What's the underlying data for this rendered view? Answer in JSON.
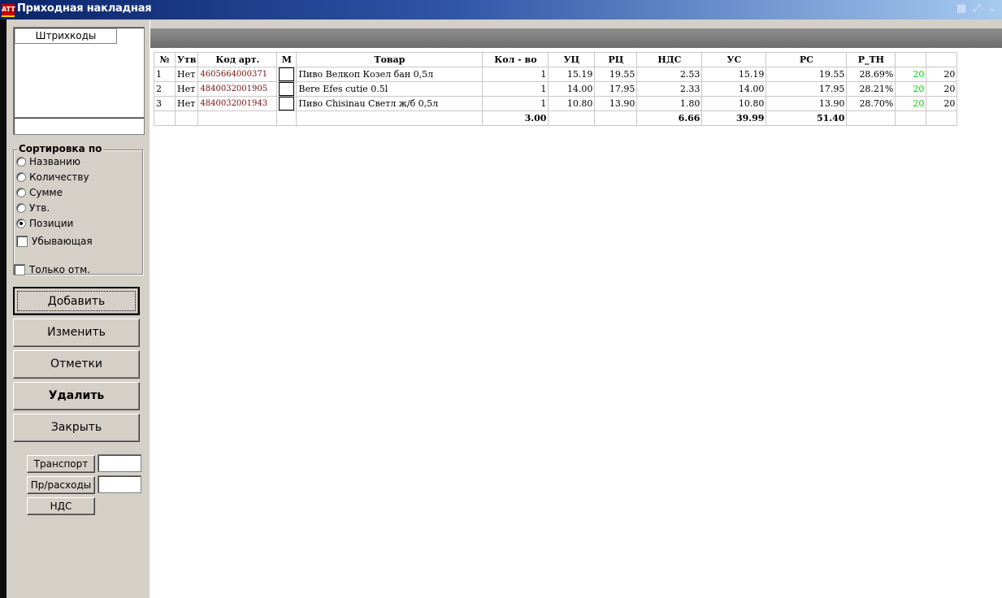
{
  "window": {
    "title": "Приходная накладная",
    "icon": "app-logo-icon",
    "icon_text": "ATT"
  },
  "left_panel": {
    "barcodes_header": "Штрихкоды",
    "search_value": "",
    "sort": {
      "title": "Сортировка по",
      "options": [
        "Названию",
        "Количеству",
        "Сумме",
        "Утв.",
        "Позиции"
      ],
      "selected": "Позиции",
      "descending_label": "Убывающая",
      "descending_checked": false
    },
    "only_marked_label": "Только отм.",
    "only_marked_checked": false,
    "buttons": {
      "add": "Добавить",
      "edit": "Изменить",
      "marks": "Отметки",
      "delete": "Удалить",
      "close": "Закрыть"
    },
    "transport_label": "Транспорт",
    "transport_value": "",
    "other_expenses_label": "Пр/расходы",
    "other_expenses_value": "",
    "vat_label": "НДС"
  },
  "table": {
    "headers": [
      "№",
      "Утв",
      "Код арт.",
      "М",
      "Товар",
      "Кол - во",
      "УЦ",
      "РЦ",
      "НДС",
      "УС",
      "РС",
      "Р_ТН",
      "",
      ""
    ],
    "rows": [
      {
        "n": "1",
        "approved": "Нет",
        "code": "4605664000371",
        "marked": false,
        "product": "Пиво Велкоп Козел бан 0,5л",
        "qty": "1",
        "uc": "15.19",
        "rc": "19.55",
        "vat": "2.53",
        "us": "15.19",
        "rs": "19.55",
        "r_tn": "28.69%",
        "c13": "20",
        "c14": "20"
      },
      {
        "n": "2",
        "approved": "Нет",
        "code": "4840032001905",
        "marked": false,
        "product": "Bere Efes  cutie 0.5l",
        "qty": "1",
        "uc": "14.00",
        "rc": "17.95",
        "vat": "2.33",
        "us": "14.00",
        "rs": "17.95",
        "r_tn": "28.21%",
        "c13": "20",
        "c14": "20"
      },
      {
        "n": "3",
        "approved": "Нет",
        "code": "4840032001943",
        "marked": false,
        "product": "Пиво Chisinau Светл ж/б 0,5л",
        "qty": "1",
        "uc": "10.80",
        "rc": "13.90",
        "vat": "1.80",
        "us": "10.80",
        "rs": "13.90",
        "r_tn": "28.70%",
        "c13": "20",
        "c14": "20"
      }
    ],
    "totals": {
      "qty": "3.00",
      "vat": "6.66",
      "us": "39.99",
      "rs": "51.40"
    }
  },
  "colors": {
    "title_gradient_start": "#0a246a",
    "title_gradient_end": "#a6caf0",
    "panel_bg": "#d4d0c8",
    "code_text": "#7a0f0f",
    "percent_green": "#00d000",
    "grid_header_bar": "#7a7a7a"
  }
}
